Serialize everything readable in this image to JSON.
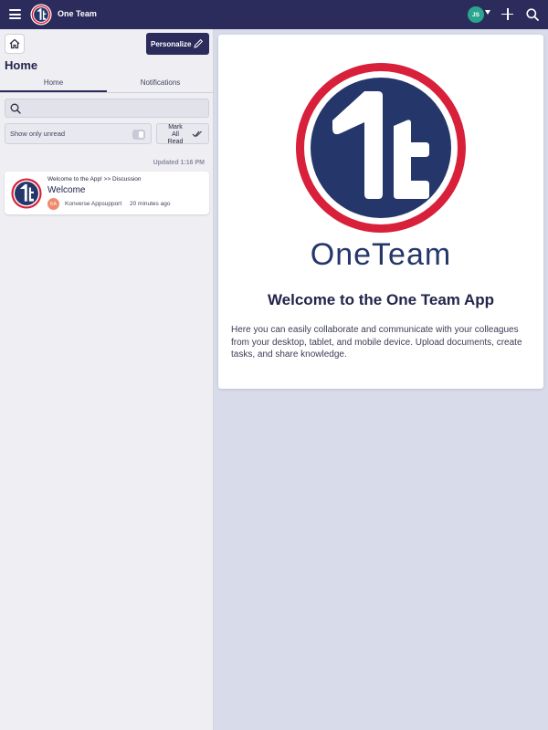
{
  "header": {
    "app_title": "One Team",
    "user_initials": "JS"
  },
  "sidebar": {
    "personalize_label": "Personalize",
    "title": "Home",
    "tabs": [
      {
        "label": "Home",
        "active": true
      },
      {
        "label": "Notifications",
        "active": false
      }
    ],
    "search": {
      "value": "",
      "placeholder": ""
    },
    "filter_unread_label": "Show only unread",
    "mark_all_read_label": "Mark All Read",
    "updated_label": "Updated 1:16 PM",
    "feed": [
      {
        "path": "Welcome to the App! >> Discussion",
        "title": "Welcome",
        "author_initials": "KA",
        "author": "Konverse Appsupport",
        "time": "20 minutes ago"
      }
    ]
  },
  "main": {
    "logo_wordmark": "OneTeam",
    "welcome_title": "Welcome to the One Team App",
    "welcome_text": "Here you can easily collaborate and communicate with your colleagues from your desktop, tablet, and mobile device. Upload documents, create tasks, and share knowledge."
  },
  "colors": {
    "header_bg": "#2b2c5c",
    "logo_red": "#d8203a",
    "logo_blue": "#25376a",
    "avatar_green": "#2aa58f",
    "author_avatar": "#f08a6e"
  },
  "icons": [
    "menu-icon",
    "home-icon",
    "pencil-icon",
    "search-icon",
    "plus-icon",
    "check-double-icon"
  ]
}
